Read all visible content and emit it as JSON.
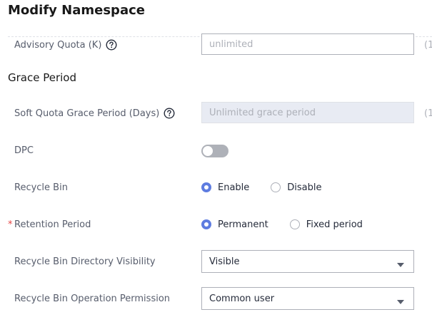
{
  "dialog": {
    "title": "Modify Namespace"
  },
  "advisory_quota": {
    "label": "Advisory Quota (K)",
    "placeholder": "unlimited",
    "suffix": "(1"
  },
  "grace_period": {
    "section_title": "Grace Period",
    "soft_quota": {
      "label": "Soft Quota Grace Period (Days)",
      "placeholder": "Unlimited grace period",
      "suffix": "(1"
    }
  },
  "dpc": {
    "label": "DPC",
    "enabled": false
  },
  "recycle_bin": {
    "label": "Recycle Bin",
    "options": [
      "Enable",
      "Disable"
    ],
    "selected": "Enable"
  },
  "retention_period": {
    "required_mark": "*",
    "label": "Retention Period",
    "options": [
      "Permanent",
      "Fixed period"
    ],
    "selected": "Permanent"
  },
  "directory_visibility": {
    "label": "Recycle Bin Directory Visibility",
    "value": "Visible"
  },
  "operation_permission": {
    "label": "Recycle Bin Operation Permission",
    "value": "Common user"
  },
  "colors": {
    "accent": "#5e7ce0",
    "required": "#e54545",
    "toggle_off": "#aeb1b8"
  },
  "icons": {
    "help": "question-circle-icon",
    "caret": "caret-down-icon"
  }
}
